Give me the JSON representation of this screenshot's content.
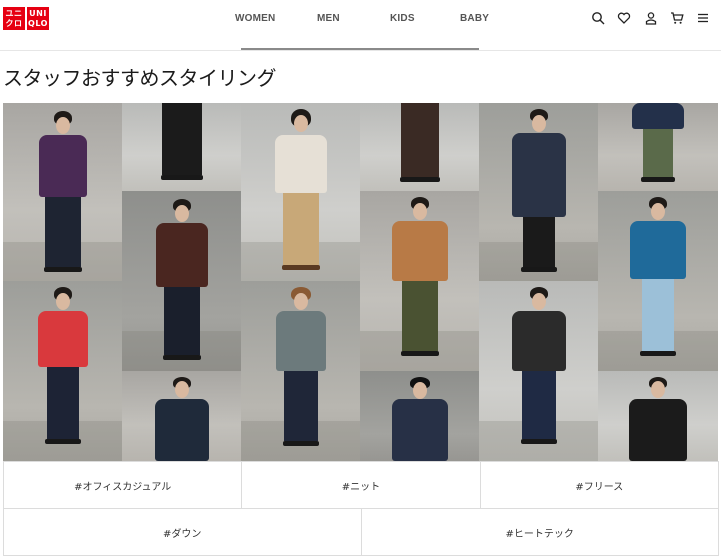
{
  "brand": {
    "logo_text_1": "ユニ",
    "logo_text_2": "クロ",
    "logo_text_3": "UNI",
    "logo_text_4": "QLO",
    "color": "#e60012"
  },
  "nav": {
    "items": [
      "WOMEN",
      "MEN",
      "KIDS",
      "BABY"
    ]
  },
  "header_icons": [
    "search-icon",
    "heart-icon",
    "user-icon",
    "cart-icon",
    "menu-icon"
  ],
  "page": {
    "title": "スタッフおすすめスタイリング"
  },
  "styling_photos": [
    {
      "outfit": "purple-fleece"
    },
    {
      "outfit": "black-wide-pants"
    },
    {
      "outfit": "beige-knit-scarf"
    },
    {
      "outfit": "brown-pants"
    },
    {
      "outfit": "navy-long-coat"
    },
    {
      "outfit": "navy-down-jacket"
    },
    {
      "outfit": "brown-parka-scarf"
    },
    {
      "outfit": "tan-down-jacket"
    },
    {
      "outfit": "blue-down-jacket"
    },
    {
      "outfit": "red-down-jacket"
    },
    {
      "outfit": "grey-quilted-jacket"
    },
    {
      "outfit": "black-down-jacket"
    },
    {
      "outfit": "navy-jacket-scarf"
    },
    {
      "outfit": "navy-hoodie-cap"
    },
    {
      "outfit": "black-coat-scarf"
    }
  ],
  "tags": {
    "row1": [
      "#オフィスカジュアル",
      "#ニット",
      "#フリース"
    ],
    "row2": [
      "#ダウン",
      "#ヒートテック"
    ]
  }
}
